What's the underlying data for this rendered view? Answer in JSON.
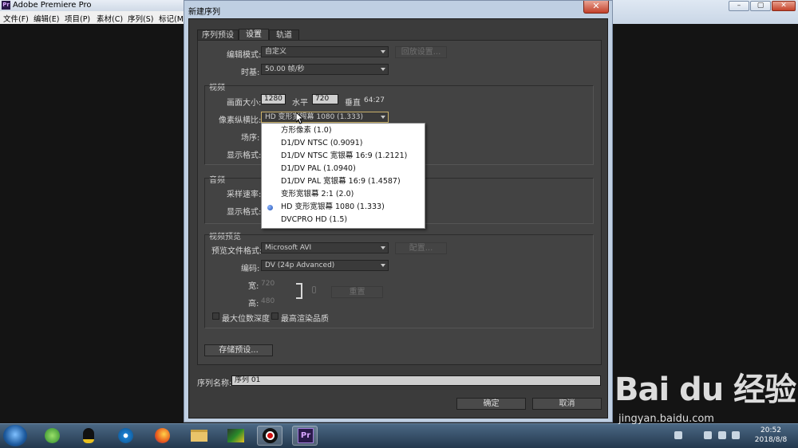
{
  "app": {
    "title": "Adobe Premiere Pro",
    "logo_text": "Pr",
    "menu": [
      "文件(F)",
      "编辑(E)",
      "项目(P)",
      "素材(C)",
      "序列(S)",
      "标记(M"
    ]
  },
  "dialog": {
    "title": "新建序列",
    "close_glyph": "✕",
    "tabs": [
      "序列预设",
      "设置",
      "轨道"
    ],
    "edit_mode": {
      "label": "编辑模式:",
      "value": "自定义"
    },
    "playback_btn": "回放设置...",
    "timebase": {
      "label": "时基:",
      "value": "50.00 帧/秒"
    },
    "video": {
      "section": "视频",
      "frame_size_label": "画面大小:",
      "width": "1280",
      "horizontal": "水平",
      "height": "720",
      "vertical": "垂直",
      "ratio": "64:27",
      "pixel_aspect_label": "像素纵横比:",
      "pixel_aspect_value": "HD 变形宽银幕 1080 (1.333)",
      "fields_label": "场序:",
      "display_format_label": "显示格式:"
    },
    "audio": {
      "section": "音频",
      "sample_rate_label": "采样速率:",
      "display_format_label": "显示格式:"
    },
    "preview": {
      "section": "视频预览",
      "file_format_label": "预览文件格式:",
      "file_format_value": "Microsoft AVI",
      "config_btn": "配置...",
      "codec_label": "编码:",
      "codec_value": "DV (24p Advanced)",
      "width_label": "宽:",
      "width_value": "720",
      "height_label": "高:",
      "height_value": "480",
      "reset_btn": "重置",
      "max_bit_depth": "最大位数深度",
      "max_render_quality": "最高渲染品质"
    },
    "save_preset_btn": "存储预设...",
    "sequence_name_label": "序列名称:",
    "sequence_name_value": "序列 01",
    "ok_btn": "确定",
    "cancel_btn": "取消"
  },
  "dropdown_menu": {
    "items": [
      "方形像素 (1.0)",
      "D1/DV NTSC (0.9091)",
      "D1/DV NTSC 宽银幕 16:9 (1.2121)",
      "D1/DV PAL (1.0940)",
      "D1/DV PAL 宽银幕 16:9 (1.4587)",
      "变形宽银幕 2:1 (2.0)",
      "HD 变形宽银幕 1080 (1.333)",
      "DVCPRO HD (1.5)"
    ],
    "selected_index": 6
  },
  "taskbar": {
    "clock_time": "20:52",
    "clock_date": "2018/8/8"
  },
  "watermark": {
    "logo": "Bai du 经验",
    "url": "jingyan.baidu.com"
  }
}
